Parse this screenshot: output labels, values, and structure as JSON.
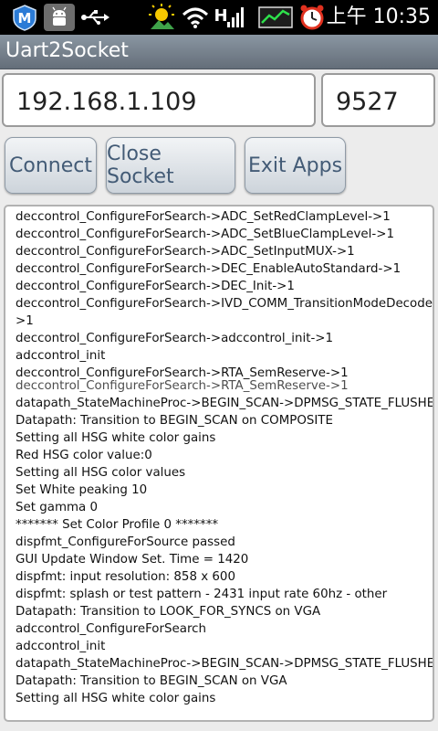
{
  "status_bar": {
    "time": "上午 10:35",
    "network": "H",
    "icons": [
      "app-m-icon",
      "android-icon",
      "usb-icon",
      "weather-icon",
      "wifi-icon",
      "signal-icon",
      "chart-icon",
      "alarm-icon"
    ]
  },
  "app": {
    "title": "Uart2Socket"
  },
  "connection": {
    "ip": "192.168.1.109",
    "port": "9527"
  },
  "buttons": {
    "connect": "Connect",
    "close_socket": "Close Socket",
    "exit_apps": "Exit Apps"
  },
  "log": [
    "deccontrol_ConfigureForSearch->ADC_SetRedClampLevel->1",
    "deccontrol_ConfigureForSearch->ADC_SetBlueClampLevel->1",
    "deccontrol_ConfigureForSearch->ADC_SetInputMUX->1",
    "deccontrol_ConfigureForSearch->DEC_EnableAutoStandard->1",
    "deccontrol_ConfigureForSearch->DEC_Init->1",
    "deccontrol_ConfigureForSearch->IVD_COMM_TransitionModeDecoder-",
    ">1",
    "deccontrol_ConfigureForSearch->adccontrol_init->1",
    "adccontrol_init",
    "deccontrol_ConfigureForSearch->RTA_SemReserve->1",
    "deccontrol_ConfigureForSearch->RTA_SemReserve->1",
    "datapath_StateMachineProc->BEGIN_SCAN->DPMSG_STATE_FLUSHED",
    "Datapath: Transition to BEGIN_SCAN on COMPOSITE",
    "Setting all HSG white color gains",
    "Red HSG color value:0",
    "Setting all HSG color values",
    "Set White peaking 10",
    "Set gamma 0",
    "******* Set Color Profile 0 *******",
    "dispfmt_ConfigureForSource passed",
    "GUI Update Window Set. Time = 1420",
    "dispfmt: input resolution: 858 x 600",
    "dispfmt: splash or test pattern - 2431 input rate 60hz - other",
    "Datapath: Transition to LOOK_FOR_SYNCS on VGA",
    "adccontrol_ConfigureForSearch",
    "adccontrol_init",
    "datapath_StateMachineProc->BEGIN_SCAN->DPMSG_STATE_FLUSHED",
    "Datapath: Transition to BEGIN_SCAN on VGA",
    "Setting all HSG white color gains"
  ]
}
